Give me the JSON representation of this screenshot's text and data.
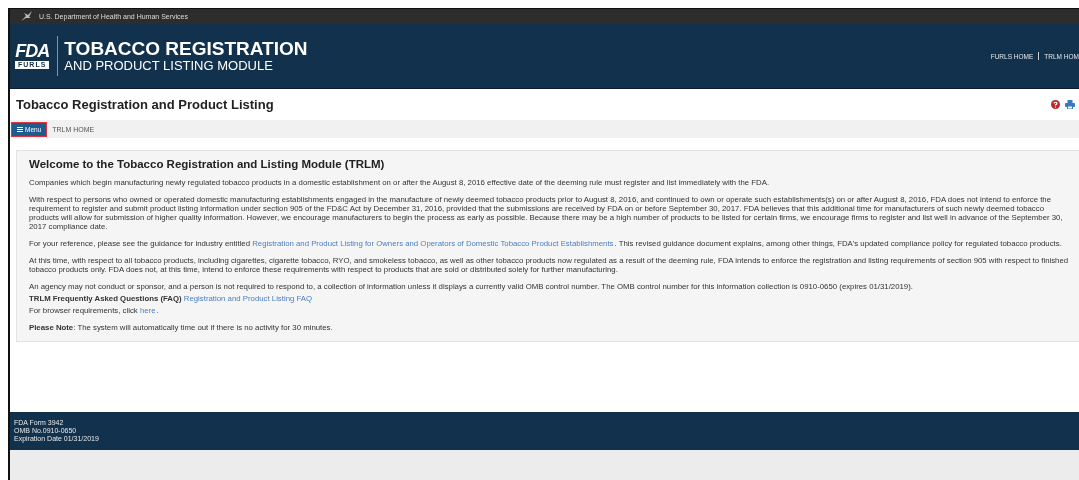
{
  "gov_bar": {
    "text": "U.S. Department of Health and Human Services"
  },
  "header": {
    "logo_text": "FDA",
    "logo_subtext": "FURLS",
    "title": "TOBACCO REGISTRATION",
    "subtitle": "AND PRODUCT LISTING MODULE",
    "nav": [
      "FURLS HOME",
      "TRLM HOM"
    ]
  },
  "page_title": "Tobacco Registration and Product Listing",
  "menu_bar": {
    "menu_button": {
      "label": "Menu",
      "outlined": true
    },
    "breadcrumb": "TRLM HOME"
  },
  "content": {
    "heading": "Welcome to the Tobacco Registration and Listing Module (TRLM)",
    "paragraphs": [
      {
        "kind": "paragraph",
        "parts": [
          {
            "kind": "text",
            "text": "Companies which begin manufacturing newly regulated tobacco products in a domestic establishment on or after the August 8, 2016 effective date of the deeming rule must register and list immediately with the FDA."
          }
        ]
      },
      {
        "kind": "paragraph",
        "parts": [
          {
            "kind": "text",
            "text": "With respect to persons who owned or operated domestic manufacturing establishments engaged in the manufacture of newly deemed tobacco products prior to August 8, 2016, and continued to own or operate such establishments(s) on or after August 8, 2016, FDA does not intend to enforce the requirement to register and submit product listing information under section 905 of the FD&C Act by December 31, 2016, provided that the submissions are received by FDA on or before September 30, 2017. FDA believes that this additional time for manufacturers of such newly deemed tobacco products will allow for submission of higher quality information. However, we encourage manufacturers to begin the process as early as possible. Because there may be a high number of products to be listed for certain firms, we encourage firms to register and list well in advance of the September 30, 2017 compliance date."
          }
        ]
      },
      {
        "kind": "paragraph",
        "parts": [
          {
            "kind": "text",
            "text": "For your reference, please see the guidance for industry entitled"
          },
          {
            "kind": "link",
            "text": "Registration and Product Listing for Owners and Operators of Domestic Tobacco Product Establishments"
          },
          {
            "kind": "text",
            "text": ". This revised guidance document explains, among other things, FDA's updated compliance policy for regulated tobacco products."
          }
        ]
      },
      {
        "kind": "paragraph",
        "parts": [
          {
            "kind": "text",
            "text": "At this time, with respect to all tobacco products, including cigarettes, cigarette tobacco, RYO, and smokeless tobacco, as well as other tobacco products now regulated as a result of the deeming rule, FDA intends to enforce the registration and listing requirements of section 905 with respect to finished tobacco products only. FDA does not, at this time, intend to enforce these requirements with respect to products that are sold or distributed solely for further manufacturing."
          }
        ]
      },
      {
        "kind": "line",
        "parts": [
          {
            "kind": "text",
            "text": "An agency may not conduct or sponsor, and a person is not required to respond to, a collection of information unless it displays a currently valid OMB control number. The OMB control number for this information collection is 0910-0650 (expires 01/31/2019)."
          }
        ]
      },
      {
        "kind": "line",
        "parts": [
          {
            "kind": "text",
            "text": "**TRLM Frequently Asked Questions (FAQ)**"
          },
          {
            "kind": "link",
            "text": "Registration and Product Listing FAQ"
          }
        ]
      },
      {
        "kind": "paragraph",
        "parts": [
          {
            "kind": "text",
            "text": "For browser requirements, click"
          },
          {
            "kind": "link",
            "text": "here"
          },
          {
            "kind": "text",
            "text": "."
          }
        ]
      },
      {
        "kind": "line",
        "parts": [
          {
            "kind": "text",
            "text": "**Please Note**: The system will automatically time out if there is no activity for 30 minutes."
          }
        ]
      }
    ]
  },
  "footer": {
    "lines": [
      "FDA Form 3942",
      "OMB No.0910-0650",
      "Expiration Date 01/31/2019"
    ]
  }
}
